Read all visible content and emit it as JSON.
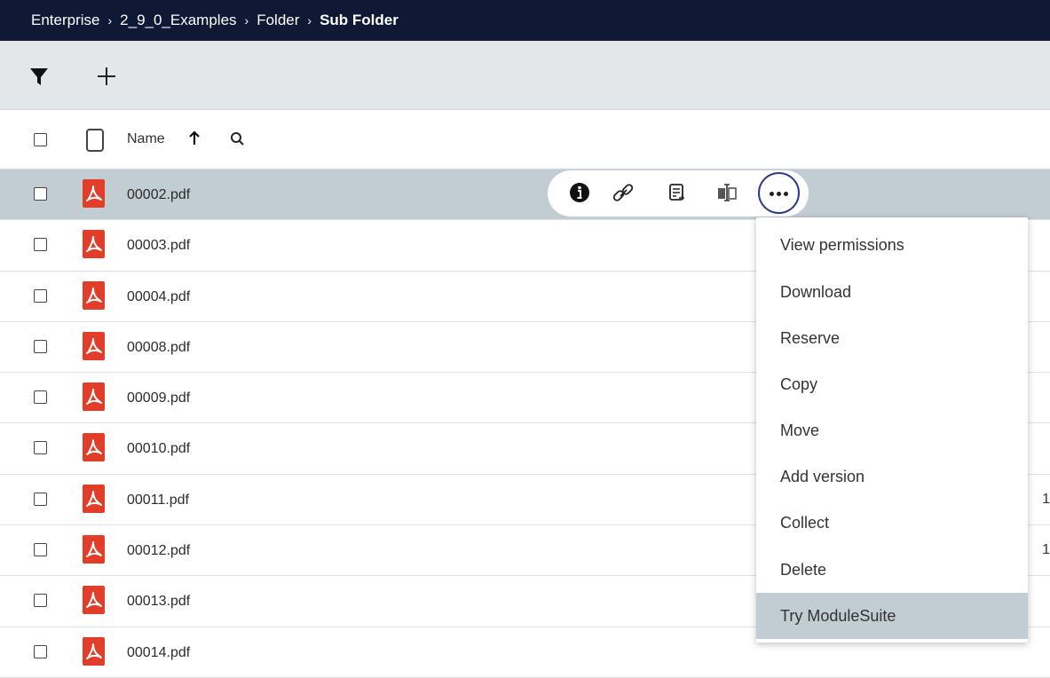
{
  "breadcrumb": {
    "items": [
      "Enterprise",
      "2_9_0_Examples",
      "Folder"
    ],
    "current": "Sub Folder",
    "separator": "›"
  },
  "toolbar": {
    "filter_icon": "filter-icon",
    "add_icon": "plus-icon"
  },
  "table": {
    "header": {
      "name_label": "Name",
      "sort_direction": "ascending"
    },
    "rows": [
      {
        "name": "00002.pdf",
        "edge": ""
      },
      {
        "name": "00003.pdf",
        "edge": ""
      },
      {
        "name": "00004.pdf",
        "edge": ""
      },
      {
        "name": "00008.pdf",
        "edge": ""
      },
      {
        "name": "00009.pdf",
        "edge": ""
      },
      {
        "name": "00010.pdf",
        "edge": ""
      },
      {
        "name": "00011.pdf",
        "edge": "1"
      },
      {
        "name": "00012.pdf",
        "edge": "1"
      },
      {
        "name": "00013.pdf",
        "edge": ""
      },
      {
        "name": "00014.pdf",
        "edge": ""
      }
    ],
    "selected_index": 0
  },
  "row_actions": [
    "info-icon",
    "link-icon",
    "properties-icon",
    "move-icon",
    "more-options-icon"
  ],
  "context_menu": {
    "items": [
      "View permissions",
      "Download",
      "Reserve",
      "Copy",
      "Move",
      "Add version",
      "Collect",
      "Delete",
      "Try ModuleSuite"
    ],
    "active_index": 8
  },
  "colors": {
    "breadcrumb_bg": "#0f1935",
    "toolbar_bg": "#e3e7ea",
    "selected_bg": "#c2ccd3",
    "pdf_red": "#e23d28",
    "focus_ring": "#2d3a8c"
  }
}
